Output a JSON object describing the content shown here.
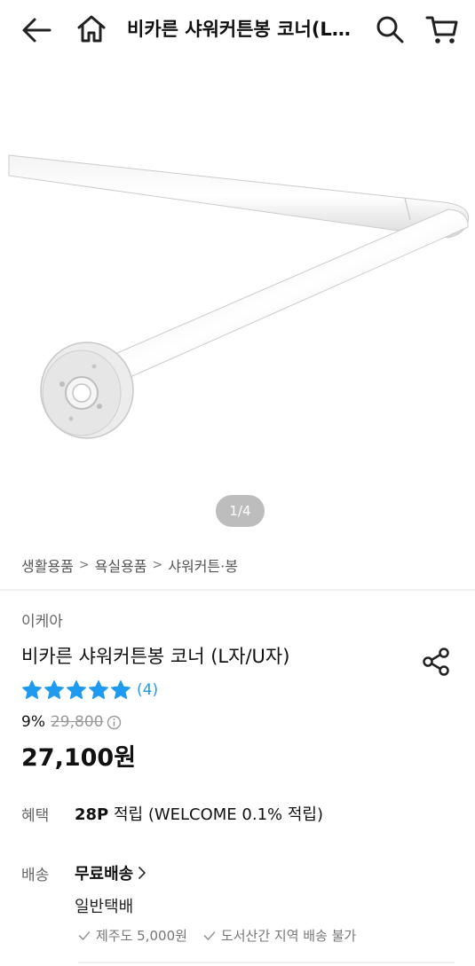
{
  "header": {
    "title": "비카른 샤워커튼봉 코너(L자/U자)",
    "icons": [
      "back-arrow-icon",
      "home-icon",
      "search-icon",
      "cart-icon"
    ]
  },
  "gallery": {
    "pager": "1/4"
  },
  "breadcrumb": [
    "생활용품",
    "욕실용품",
    "샤워커튼·봉"
  ],
  "product": {
    "brand": "이케아",
    "title": "비카른 샤워커튼봉 코너 (L자/U자)",
    "rating_stars": 5,
    "review_count": "(4)",
    "discount_rate": "9%",
    "original_price": "29,800",
    "price": "27,100원"
  },
  "benefit": {
    "label": "혜택",
    "points": "28P",
    "text": " 적립 (WELCOME 0.1% 적립)"
  },
  "shipping": {
    "label": "배송",
    "main": "무료배송",
    "type": "일반택배",
    "notes": [
      "제주도 5,000원",
      "도서산간 지역 배송 불가"
    ]
  },
  "colors": {
    "star": "#1e9bf0",
    "pager_bg": "#bdbdbd"
  }
}
